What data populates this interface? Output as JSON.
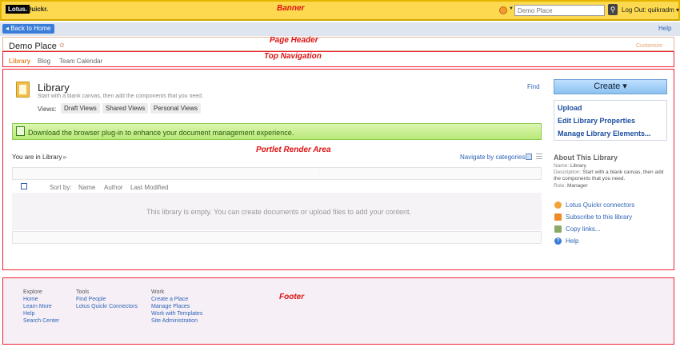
{
  "banner": {
    "region_label": "Banner",
    "logo_lotus": "Lotus.",
    "logo_quickr": "Quickr.",
    "search_placeholder": "Demo Place",
    "search_button_icon": "search-icon",
    "logout_label": "Log Out: quikradm ▾"
  },
  "subbar": {
    "back_label": "◂ Back to Home",
    "help_label": "Help"
  },
  "page_header": {
    "region_label": "Page Header",
    "title": "Demo Place",
    "customize_label": "Customize"
  },
  "top_nav": {
    "region_label": "Top Navigation",
    "items": [
      {
        "label": "Library",
        "active": true
      },
      {
        "label": "Blog",
        "active": false
      },
      {
        "label": "Team Calendar",
        "active": false
      }
    ]
  },
  "portlet": {
    "region_label": "Portlet Render Area",
    "library_title": "Library",
    "library_subtitle": "Start with a blank canvas, then add the components that you need.",
    "views_label": "Views:",
    "views": [
      "Draft Views",
      "Shared Views",
      "Personal Views"
    ],
    "find_label": "Find",
    "create_label": "Create ▾",
    "actions": [
      "Upload",
      "Edit Library Properties",
      "Manage Library Elements..."
    ],
    "plugin_message": "Download the browser plug-in to enhance your document management experience.",
    "breadcrumb": "You are in Library ▹",
    "navigate_label": "Navigate by categories",
    "table_top_marker": ".",
    "sort_label": "Sort by:",
    "sort_columns": [
      "Name",
      "Author",
      "Last Modified"
    ],
    "empty_message": "This library is empty. You can create documents or upload files to add your content.",
    "about": {
      "title": "About This Library",
      "name_key": "Name:",
      "name_value": "Library",
      "description_key": "Description:",
      "description_line1": "Start with a blank canvas, then add",
      "description_line2": "the components that you need.",
      "role_key": "Role:",
      "role_value": "Manager"
    },
    "side_links": [
      "Lotus Quickr connectors",
      "Subscribe to this library",
      "Copy links...",
      "Help"
    ]
  },
  "footer": {
    "region_label": "Footer",
    "columns": [
      {
        "heading": "Explore",
        "links": [
          "Home",
          "Learn More",
          "Help",
          "Search Center"
        ]
      },
      {
        "heading": "Tools",
        "links": [
          "Find People",
          "Lotus Quickr Connectors"
        ]
      },
      {
        "heading": "Work",
        "links": [
          "Create a Place",
          "Manage Places",
          "Work with Templates",
          "Site Administration"
        ]
      }
    ]
  },
  "colors": {
    "banner": "#fcd94e",
    "region_outline": "#e22233",
    "link": "#2e64b7",
    "plugin_bar": "#c6ee8e"
  }
}
